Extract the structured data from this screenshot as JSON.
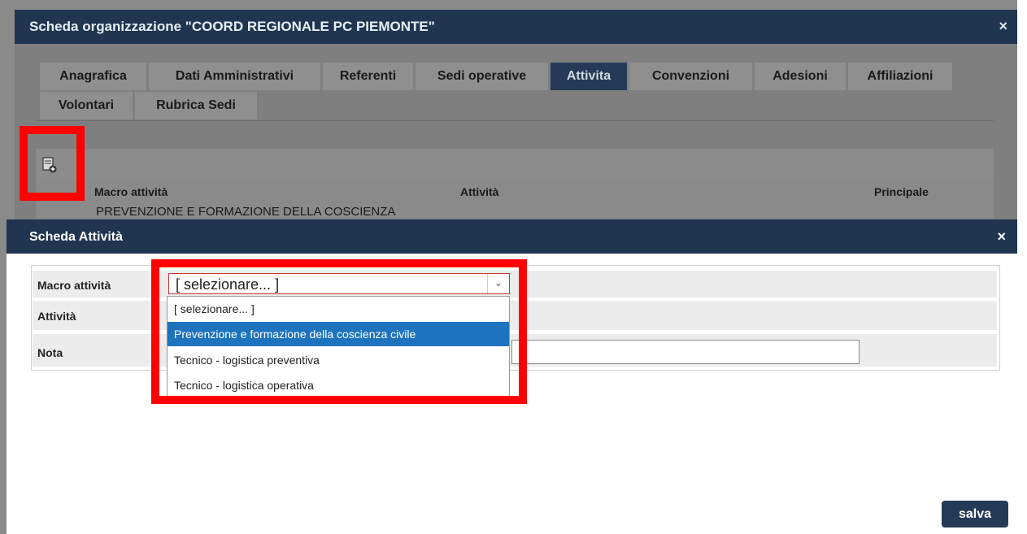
{
  "back_dialog": {
    "title": "Scheda organizzazione \"COORD REGIONALE PC PIEMONTE\"",
    "close": "×",
    "tabs": [
      {
        "label": "Anagrafica"
      },
      {
        "label": "Dati Amministrativi"
      },
      {
        "label": "Referenti"
      },
      {
        "label": "Sedi operative"
      },
      {
        "label": "Attivita"
      },
      {
        "label": "Convenzioni"
      },
      {
        "label": "Adesioni"
      },
      {
        "label": "Affiliazioni"
      },
      {
        "label": "Volontari"
      },
      {
        "label": "Rubrica Sedi"
      }
    ],
    "active_tab": "Attivita",
    "grid": {
      "headers": {
        "macro": "Macro attività",
        "attivita": "Attività",
        "principale": "Principale"
      },
      "row_macro": "PREVENZIONE E FORMAZIONE DELLA COSCIENZA"
    }
  },
  "front_dialog": {
    "title": "Scheda Attività",
    "close": "×",
    "labels": {
      "macro": "Macro attività",
      "attivita": "Attività",
      "nota": "Nota"
    },
    "select_value": "[ selezionare... ]",
    "options": [
      "[ selezionare... ]",
      "Prevenzione e formazione della coscienza civile",
      "Tecnico - logistica preventiva",
      "Tecnico - logistica operativa"
    ],
    "selected_option_index": 1,
    "save_label": "salva"
  },
  "colors": {
    "title_bar": "#1f3550",
    "highlight": "#1e73be",
    "annotation": "#ff0000"
  }
}
